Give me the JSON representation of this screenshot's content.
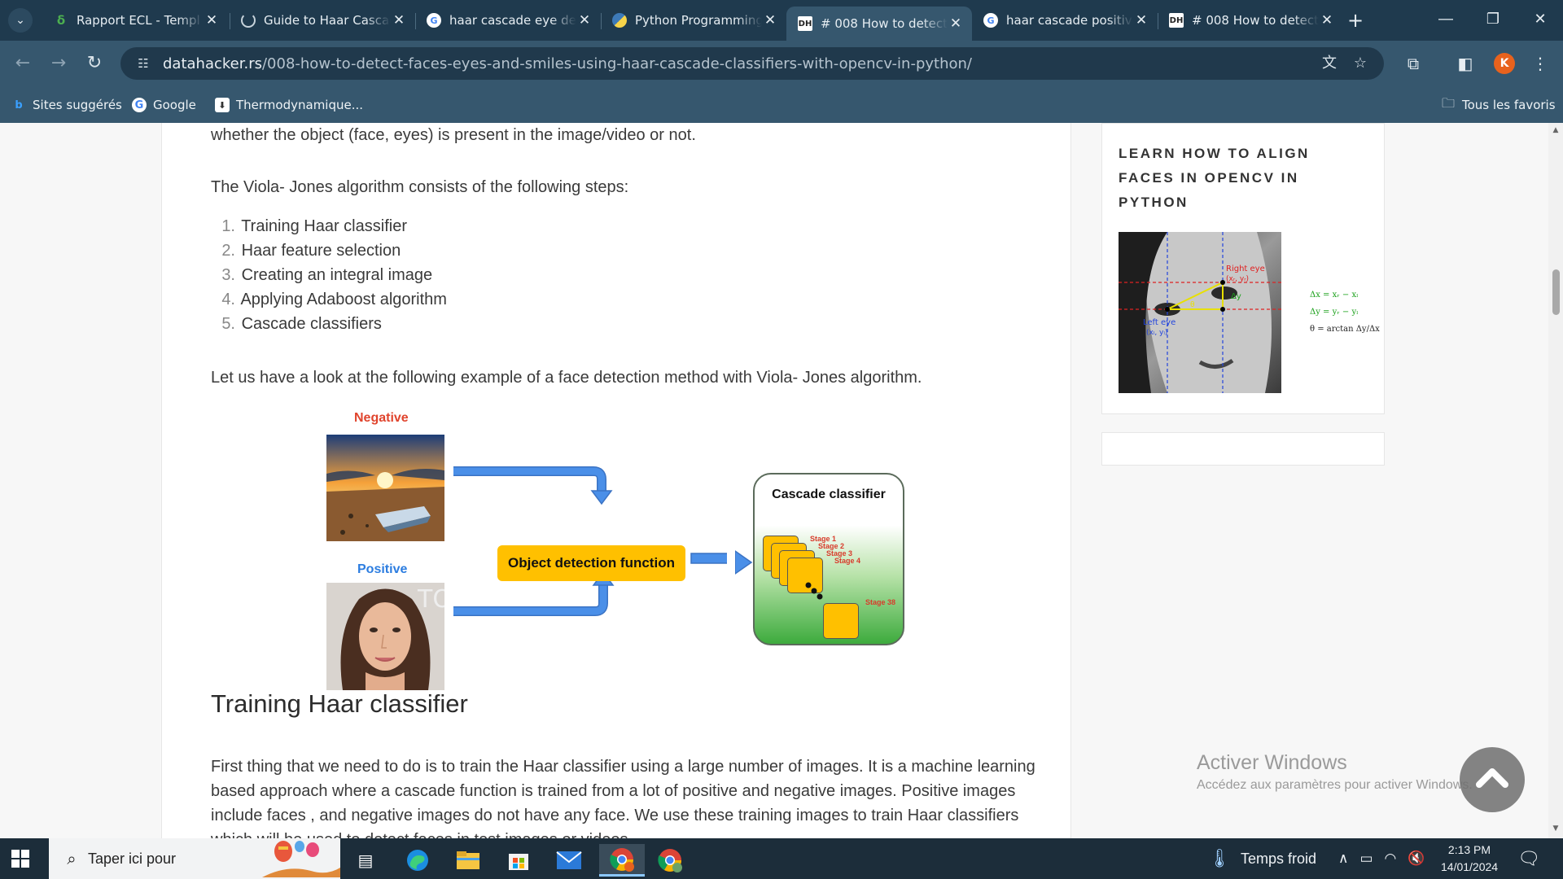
{
  "browser": {
    "tabs": [
      {
        "title": "Rapport ECL - Templ",
        "favicon": "overleaf-icon",
        "active": false
      },
      {
        "title": "Guide to Haar Cascad",
        "favicon": "loading-icon",
        "active": false
      },
      {
        "title": "haar cascade eye dete",
        "favicon": "google-icon",
        "active": false
      },
      {
        "title": "Python Programming",
        "favicon": "python-icon",
        "active": false
      },
      {
        "title": "# 008 How to detect",
        "favicon": "datahacker-icon",
        "active": true
      },
      {
        "title": "haar cascade positive",
        "favicon": "google-icon",
        "active": false
      },
      {
        "title": "# 008 How to detect",
        "favicon": "datahacker-icon",
        "active": false
      }
    ],
    "url_domain": "datahacker.rs",
    "url_path": "/008-how-to-detect-faces-eyes-and-smiles-using-haar-cascade-classifiers-with-opencv-in-python/",
    "avatar_letter": "K",
    "bookmarks": [
      {
        "label": "Sites suggérés",
        "icon": "bing-icon"
      },
      {
        "label": "Google",
        "icon": "google-icon"
      },
      {
        "label": "Thermodynamique...",
        "icon": "bookmark-page-icon"
      }
    ],
    "all_bookmarks": "Tous les favoris"
  },
  "article": {
    "line_top": "whether the object (face, eyes) is present in the image/video or not.",
    "intro": "The Viola- Jones algorithm consists of the following steps:",
    "steps": [
      {
        "num": "1.",
        "text": "Training Haar classifier"
      },
      {
        "num": "2.",
        "text": "Haar feature selection"
      },
      {
        "num": "3.",
        "text": "Creating an integral image"
      },
      {
        "num": "4.",
        "text": "Applying Adaboost algorithm"
      },
      {
        "num": "5.",
        "text": "Cascade classifiers"
      }
    ],
    "example": "Let us have a look at the following example of a face detection method with Viola- Jones algorithm.",
    "diagram": {
      "negative": "Negative",
      "positive": "Positive",
      "function": "Object detection function",
      "cascade": "Cascade classifier",
      "stages": [
        "Stage 1",
        "Stage 2",
        "Stage 3",
        "Stage 4",
        "Stage 38"
      ],
      "colors": {
        "arrow": "#4a8fe8",
        "box": "#ffc000",
        "negative": "#e0442d",
        "positive": "#2c7de0"
      }
    },
    "heading": "Training Haar classifier",
    "paragraph": "First thing that we need to do is to train the Haar classifier using a large number of images. It is a machine learning based approach where a cascade function is trained from a lot of positive and negative images. Positive images include faces , and negative images do not have any face. We use these training images to train Haar classifiers which will be used to detect faces in test images or videos."
  },
  "sidebar": {
    "title": "LEARN HOW TO ALIGN FACES IN OPENCV IN PYTHON",
    "image_labels": {
      "right_eye": "Right eye",
      "right_eye_coords": "(xᵣ, yᵣ)",
      "left_eye": "Left eye",
      "left_eye_coords": "(xₗ, yₗ)",
      "dy": "Δy",
      "theta": "θ"
    },
    "formulas": [
      "Δx = xᵣ − xₗ",
      "Δy = yᵣ − yₗ",
      "θ = arctan Δy/Δx"
    ]
  },
  "watermark": {
    "title": "Activer Windows",
    "subtitle": "Accédez aux paramètres pour activer Windows."
  },
  "taskbar": {
    "search_placeholder": "Taper ici pour",
    "weather": "Temps froid",
    "time": "2:13 PM",
    "date": "14/01/2024"
  }
}
